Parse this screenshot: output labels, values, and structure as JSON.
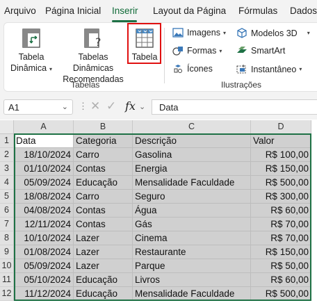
{
  "tabs": [
    "Arquivo",
    "Página Inicial",
    "Inserir",
    "Layout da Página",
    "Fórmulas",
    "Dados"
  ],
  "ribbon": {
    "tabela_dinamica": [
      "Tabela",
      "Dinâmica"
    ],
    "tabelas_recomendadas": [
      "Tabelas Dinâmicas",
      "Recomendadas"
    ],
    "tabela": "Tabela",
    "group_tabelas": "Tabelas",
    "imagens": "Imagens",
    "formas": "Formas",
    "icones": "Ícones",
    "modelos3d": "Modelos 3D",
    "smartart": "SmartArt",
    "instantaneo": "Instantâneo",
    "group_ilustracoes": "Ilustrações"
  },
  "formula_bar": {
    "name_box": "A1",
    "formula": "Data"
  },
  "grid": {
    "columns": [
      "A",
      "B",
      "C",
      "D"
    ],
    "rows": [
      [
        "Data",
        "Categoria",
        "Descrição",
        "Valor"
      ],
      [
        "18/10/2024",
        "Carro",
        "Gasolina",
        "R$ 100,00"
      ],
      [
        "01/10/2024",
        "Contas",
        "Energia",
        "R$ 150,00"
      ],
      [
        "05/09/2024",
        "Educação",
        "Mensalidade Faculdade",
        "R$ 500,00"
      ],
      [
        "18/08/2024",
        "Carro",
        "Seguro",
        "R$ 300,00"
      ],
      [
        "04/08/2024",
        "Contas",
        "Água",
        "R$ 60,00"
      ],
      [
        "12/11/2024",
        "Contas",
        "Gás",
        "R$ 70,00"
      ],
      [
        "10/10/2024",
        "Lazer",
        "Cinema",
        "R$ 70,00"
      ],
      [
        "01/08/2024",
        "Lazer",
        "Restaurante",
        "R$ 150,00"
      ],
      [
        "05/09/2024",
        "Lazer",
        "Parque",
        "R$ 50,00"
      ],
      [
        "05/10/2024",
        "Educação",
        "Livros",
        "R$ 60,00"
      ],
      [
        "11/12/2024",
        "Educação",
        "Mensalidade Faculdade",
        "R$ 500,00"
      ]
    ]
  },
  "colors": {
    "accent": "#1e7145",
    "highlight": "#e01010",
    "selection_fill": "#d0d0d0"
  }
}
